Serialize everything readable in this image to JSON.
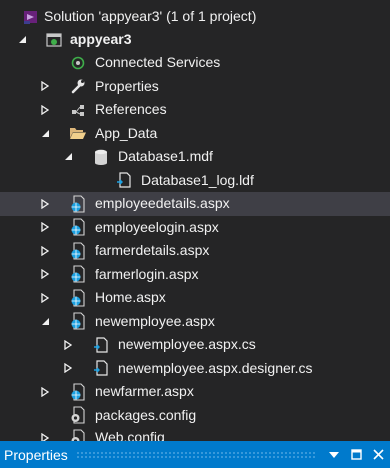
{
  "solution_label": "Solution 'appyear3' (1 of 1 project)",
  "project_label": "appyear3",
  "items": {
    "connected_services": "Connected Services",
    "properties": "Properties",
    "references": "References",
    "app_data": "App_Data",
    "database1_mdf": "Database1.mdf",
    "database1_log": "Database1_log.ldf",
    "employeedetails": "employeedetails.aspx",
    "employeelogin": "employeelogin.aspx",
    "farmerdetails": "farmerdetails.aspx",
    "farmerlogin": "farmerlogin.aspx",
    "home": "Home.aspx",
    "newemployee": "newemployee.aspx",
    "newemployee_cs": "newemployee.aspx.cs",
    "newemployee_designer": "newemployee.aspx.designer.cs",
    "newfarmer": "newfarmer.aspx",
    "packages_config": "packages.config",
    "web_config": "Web.config"
  },
  "properties_panel": {
    "title": "Properties"
  },
  "colors": {
    "background": "#252526",
    "selected_row": "#3f3f46",
    "panel_header": "#007acc",
    "text": "#f1f1f1"
  }
}
